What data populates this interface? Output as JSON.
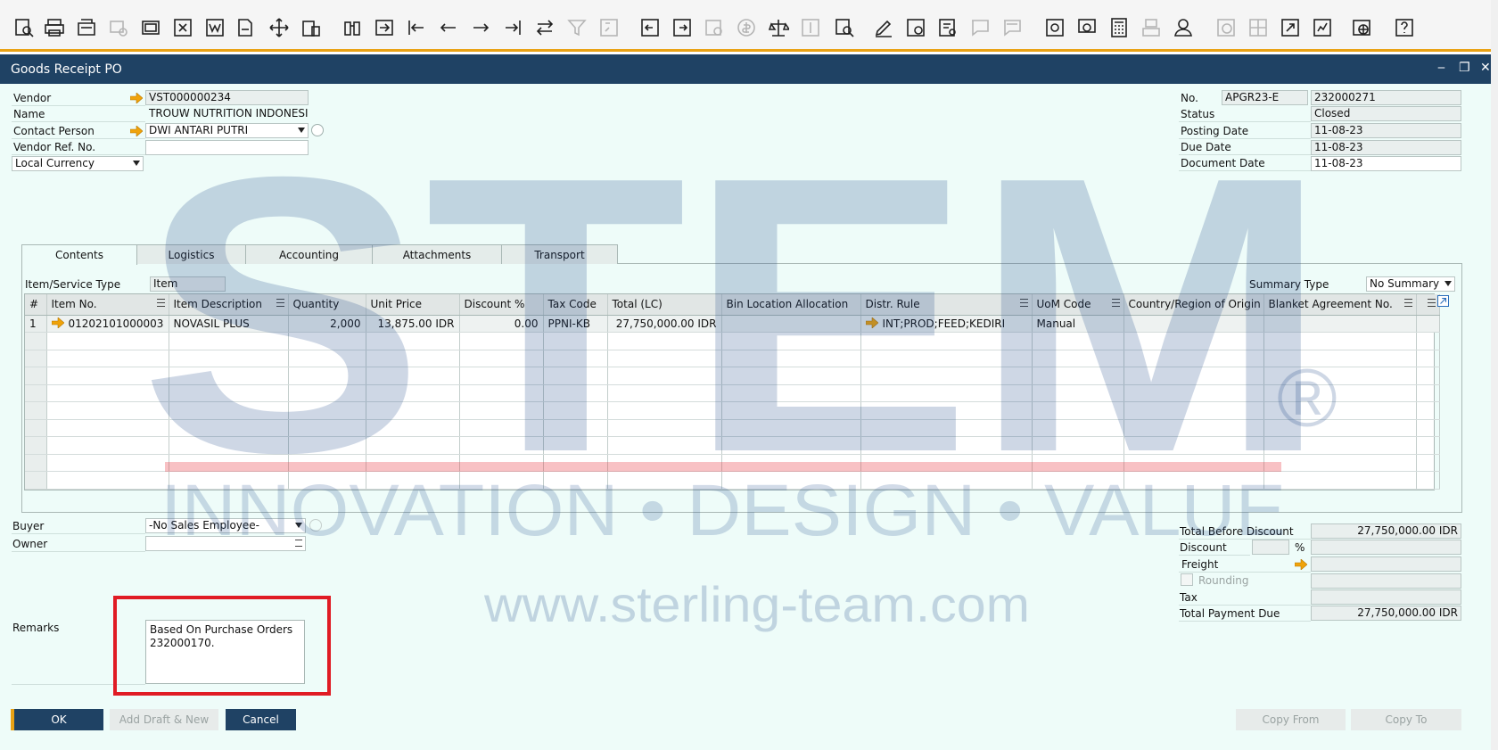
{
  "toolbar": {
    "icons": [
      "find-icon",
      "print-preview-icon",
      "print-icon",
      "send-icon",
      "email-icon",
      "export-excel-icon",
      "export-word-icon",
      "export-pdf-icon",
      "move-icon",
      "launch-app-icon",
      "find-record-icon",
      "go-to-icon",
      "first-record-icon",
      "previous-record-icon",
      "next-record-icon",
      "last-record-icon",
      "refresh-icon",
      "filter-icon",
      "sort-icon",
      "base-document-icon",
      "target-document-icon",
      "payment-means-icon",
      "exchange-rate-icon",
      "balance-icon",
      "gross-profit-icon",
      "query-icon",
      "edit-icon",
      "settings-icon",
      "form-settings-icon",
      "message-icon",
      "alert-icon",
      "approval-icon",
      "activity-icon",
      "calculator-icon",
      "group-icon",
      "user-icon",
      "time-icon",
      "layout-icon",
      "export-icon",
      "report-icon",
      "browser-icon",
      "help-icon"
    ]
  },
  "window": {
    "title": "Goods Receipt PO",
    "controls": {
      "minimize": "‒",
      "restore": "❐",
      "close": "✕"
    }
  },
  "header_left": {
    "vendor_label": "Vendor",
    "vendor_value": "VST000000234",
    "name_label": "Name",
    "name_value": "TROUW NUTRITION INDONESIA",
    "contact_label": "Contact Person",
    "contact_value": "DWI ANTARI PUTRI",
    "vendor_ref_label": "Vendor Ref. No.",
    "vendor_ref_value": "",
    "currency_value": "Local Currency"
  },
  "header_right": {
    "no_label": "No.",
    "series_value": "APGR23-E",
    "no_value": "232000271",
    "status_label": "Status",
    "status_value": "Closed",
    "posting_label": "Posting Date",
    "posting_value": "11-08-23",
    "due_label": "Due Date",
    "due_value": "11-08-23",
    "document_label": "Document Date",
    "document_value": "11-08-23"
  },
  "tabs": [
    "Contents",
    "Logistics",
    "Accounting",
    "Attachments",
    "Transport"
  ],
  "contents": {
    "item_type_label": "Item/Service Type",
    "item_type_value": "Item",
    "summary_label": "Summary Type",
    "summary_value": "No Summary"
  },
  "grid": {
    "columns": [
      "#",
      "Item No.",
      "Item Description",
      "Quantity",
      "Unit Price",
      "Discount %",
      "Tax Code",
      "Total (LC)",
      "Bin Location Allocation",
      "Distr. Rule",
      "UoM Code",
      "Country/Region of Origin",
      "Blanket Agreement No.",
      ""
    ],
    "rows": [
      [
        "1",
        "01202101000003",
        "NOVASIL PLUS",
        "2,000",
        "13,875.00 IDR",
        "0.00",
        "PPNI-KB",
        "27,750,000.00 IDR",
        "",
        "INT;PROD;FEED;KEDIRI",
        "Manual",
        "",
        "",
        ""
      ]
    ],
    "empty_rows": 9
  },
  "footer_left": {
    "buyer_label": "Buyer",
    "buyer_value": "-No Sales Employee-",
    "owner_label": "Owner",
    "owner_value": "",
    "remarks_label": "Remarks",
    "remarks_value": "Based On Purchase Orders\n232000170."
  },
  "totals": {
    "total_before_label": "Total Before Discount",
    "total_before_value": "27,750,000.00 IDR",
    "discount_label": "Discount",
    "discount_pct_value": "",
    "pct_symbol": "%",
    "discount_value": "",
    "freight_label": "Freight",
    "freight_value": "",
    "rounding_label": "Rounding",
    "rounding_value": "",
    "tax_label": "Tax",
    "tax_value": "",
    "total_due_label": "Total Payment Due",
    "total_due_value": "27,750,000.00 IDR"
  },
  "buttons": {
    "ok": "OK",
    "add_draft": "Add Draft & New",
    "cancel": "Cancel",
    "copy_from": "Copy From",
    "copy_to": "Copy To"
  },
  "watermark": {
    "logo_text": "STEM",
    "registered": "®",
    "tagline": "INNOVATION • DESIGN • VALUE",
    "url": "www.sterling-team.com"
  },
  "colors": {
    "accent": "#e9a215",
    "titlebar": "#1f4264",
    "background": "#eefcf9",
    "highlight": "#e01b24",
    "arrow": "#f0a30a"
  }
}
